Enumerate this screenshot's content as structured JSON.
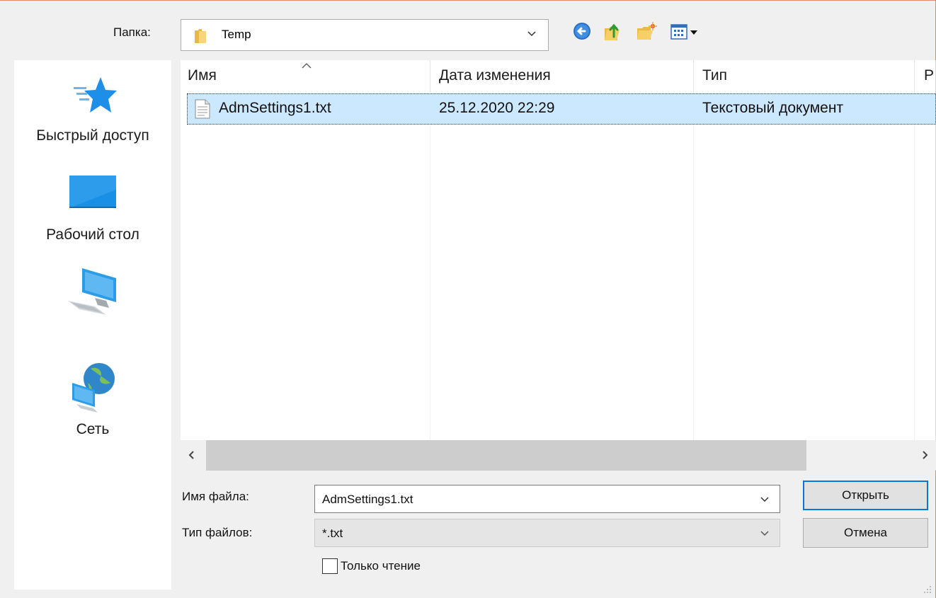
{
  "topbar": {
    "folder_label": "Папка:",
    "folder_value": "Temp",
    "toolbar_icons": [
      "back-icon",
      "up-folder-icon",
      "new-folder-icon",
      "view-menu-icon"
    ]
  },
  "places": [
    {
      "label": "Быстрый доступ",
      "icon": "quick-access-star-icon"
    },
    {
      "label": "Рабочий стол",
      "icon": "desktop-icon"
    },
    {
      "label": "",
      "icon": "this-pc-icon"
    },
    {
      "label": "Сеть",
      "icon": "network-icon"
    }
  ],
  "list": {
    "columns": [
      "Имя",
      "Дата изменения",
      "Тип",
      "Р"
    ],
    "rows": [
      {
        "name": "AdmSettings1.txt",
        "date": "25.12.2020 22:29",
        "type": "Текстовый документ",
        "selected": true
      }
    ],
    "scroll": {
      "left_arrow": "‹",
      "right_arrow": "›"
    }
  },
  "form": {
    "filename_label": "Имя файла:",
    "filename_value": "AdmSettings1.txt",
    "filetype_label": "Тип файлов:",
    "filetype_value": "*.txt",
    "open_button": "Открыть",
    "cancel_button": "Отмена",
    "readonly_label": "Только чтение",
    "readonly_checked": false
  },
  "colors": {
    "selection": "#cce8ff",
    "accent": "#0078d7",
    "window_bg": "#f0f0f0",
    "frame": "#e08a6c"
  }
}
